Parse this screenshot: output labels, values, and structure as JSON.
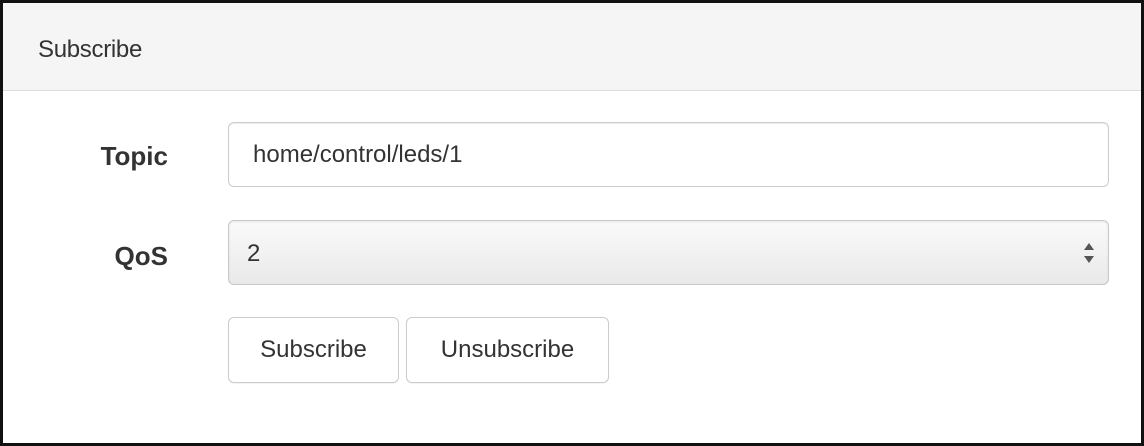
{
  "panel": {
    "title": "Subscribe"
  },
  "form": {
    "topic": {
      "label": "Topic",
      "value": "home/control/leds/1"
    },
    "qos": {
      "label": "QoS",
      "selected": "2",
      "icon": "sort-arrows-icon"
    },
    "buttons": {
      "subscribe_label": "Subscribe",
      "unsubscribe_label": "Unsubscribe"
    }
  }
}
